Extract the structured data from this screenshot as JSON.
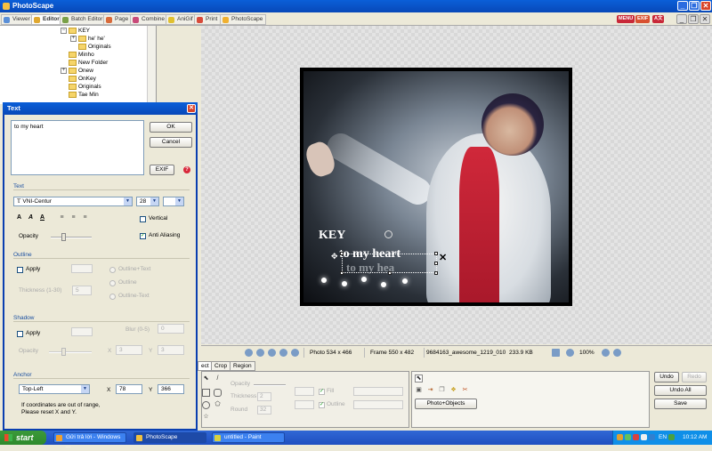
{
  "app": {
    "title": "PhotoScape"
  },
  "tabs": [
    {
      "label": "Viewer"
    },
    {
      "label": "Editor"
    },
    {
      "label": "Batch Editor"
    },
    {
      "label": "Page"
    },
    {
      "label": "Combine"
    },
    {
      "label": "AniGif"
    },
    {
      "label": "Print"
    },
    {
      "label": "PhotoScape"
    }
  ],
  "header_badges": {
    "menu": "MENU",
    "exif": "EXIF",
    "lang": "A文"
  },
  "tree": {
    "items": [
      {
        "label": "KEY"
      },
      {
        "label": "he' he'"
      },
      {
        "label": "Originals"
      },
      {
        "label": "Minho"
      },
      {
        "label": "New Folder"
      },
      {
        "label": "Onew"
      },
      {
        "label": "OnKey"
      },
      {
        "label": "Originals"
      },
      {
        "label": "Tae Min"
      }
    ]
  },
  "photo": {
    "overlay_key": "KEY",
    "overlay_heart": "to my heart",
    "overlay_heart_shadow": "to my hea"
  },
  "status": {
    "photo_size": "Photo 534 x 466",
    "frame_size": "Frame 550 x 482",
    "filename": "9684163_awesome_1219_010",
    "filesize": "233.9 KB",
    "zoom": "100%"
  },
  "bottom": {
    "tabs": [
      "ect",
      "Crop",
      "Region"
    ],
    "opacity_label": "Opacity",
    "thickness_label": "Thickness",
    "thickness_value": "2",
    "round_label": "Round",
    "round_value": "32",
    "fill_label": "Fill",
    "outline_label": "Outline",
    "photo_objects_button": "Photo+Objects",
    "undo": "Undo",
    "redo": "Redo",
    "undo_all": "Undo All",
    "save": "Save"
  },
  "dialog": {
    "title": "Text",
    "text_value": "to my heart",
    "ok": "OK",
    "cancel": "Cancel",
    "exif": "EXIF",
    "text_section": "Text",
    "font": "VNI-Centur",
    "font_size": "28",
    "vertical": "Vertical",
    "anti_aliasing": "Anti Aliasing",
    "opacity": "Opacity",
    "outline_section": "Outline",
    "apply": "Apply",
    "outline_plus_text": "Outline+Text",
    "outline": "Outline",
    "outline_minus_text": "Outline-Text",
    "thickness_label": "Thickness (1-30)",
    "thickness_value": "5",
    "shadow_section": "Shadow",
    "shadow_apply": "Apply",
    "blur_label": "Blur (0-5)",
    "blur_value": "0",
    "shadow_opacity": "Opacity",
    "shadow_x_label": "X",
    "shadow_x_value": "3",
    "shadow_y_label": "Y",
    "shadow_y_value": "3",
    "anchor_section": "Anchor",
    "anchor_value": "Top-Left",
    "x_label": "X",
    "x_value": "78",
    "y_label": "Y",
    "y_value": "366",
    "note_line1": "If coordinates are out of range,",
    "note_line2": "Please reset X and Y."
  },
  "taskbar": {
    "start": "start",
    "items": [
      {
        "label": "Gửi trả lời - Windows ..."
      },
      {
        "label": "PhotoScape"
      },
      {
        "label": "untitled - Paint"
      }
    ],
    "clock": "10:12 AM",
    "lang": "EN"
  },
  "colors": {
    "titlebar_blue": "#0848b8",
    "window_bg": "#ece9d8",
    "start_green": "#2e8a2c",
    "shirt_red": "#c0203a"
  }
}
